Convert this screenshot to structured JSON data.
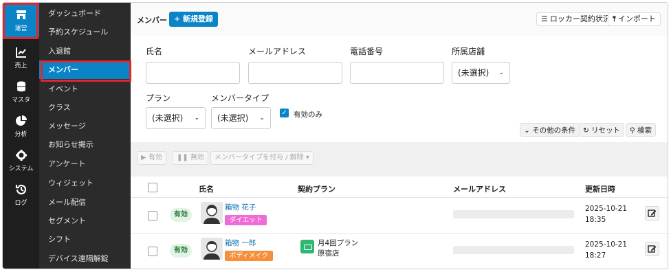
{
  "rail": {
    "items": [
      {
        "label": "運営",
        "icon": "store-icon",
        "active": true
      },
      {
        "label": "売上",
        "icon": "chart-line-icon"
      },
      {
        "label": "マスタ",
        "icon": "database-icon"
      },
      {
        "label": "分析",
        "icon": "pie-chart-icon"
      },
      {
        "label": "システム",
        "icon": "gear-icon"
      },
      {
        "label": "ログ",
        "icon": "history-icon"
      }
    ]
  },
  "nav": {
    "items": [
      {
        "label": "ダッシュボード"
      },
      {
        "label": "予約スケジュール"
      },
      {
        "label": "入退館"
      },
      {
        "label": "メンバー",
        "active": true
      },
      {
        "label": "イベント"
      },
      {
        "label": "クラス"
      },
      {
        "label": "メッセージ"
      },
      {
        "label": "お知らせ掲示"
      },
      {
        "label": "アンケート"
      },
      {
        "label": "ウィジェット"
      },
      {
        "label": "メール配信"
      },
      {
        "label": "セグメント"
      },
      {
        "label": "シフト"
      },
      {
        "label": "デバイス遠隔解錠"
      }
    ]
  },
  "header": {
    "title": "メンバー",
    "new_button": "新規登録",
    "locker_button": "ロッカー契約状況",
    "import_button": "インポート"
  },
  "search": {
    "name_label": "氏名",
    "name_value": "",
    "email_label": "メールアドレス",
    "email_value": "",
    "phone_label": "電話番号",
    "phone_value": "",
    "store_label": "所属店舗",
    "store_value": "(未選択)",
    "plan_label": "プラン",
    "plan_value": "(未選択)",
    "type_label": "メンバータイプ",
    "type_value": "(未選択)",
    "active_only_label": "有効のみ",
    "active_only_checked": true,
    "more_conditions": "その他の条件",
    "reset": "リセット",
    "search": "検索"
  },
  "actions": {
    "enable": "有効",
    "disable": "無効",
    "member_type": "メンバータイプを付与 / 解除"
  },
  "table": {
    "headers": {
      "name": "氏名",
      "plan": "契約プラン",
      "email": "メールアドレス",
      "updated": "更新日時"
    },
    "rows": [
      {
        "status": "有効",
        "name": "箱物 花子",
        "tag": "ダイエット",
        "tag_color": "#f06bd6",
        "avatar": "female",
        "plan_name": "",
        "plan_store": "",
        "has_plan": false,
        "updated_date": "2025-10-21",
        "updated_time": "18:35"
      },
      {
        "status": "有効",
        "name": "箱物 一郎",
        "tag": "ボディメイク",
        "tag_color": "#f58f3b",
        "avatar": "male",
        "plan_name": "月4回プラン",
        "plan_store": "原宿店",
        "has_plan": true,
        "updated_date": "2025-10-21",
        "updated_time": "18:27"
      }
    ]
  },
  "colors": {
    "accent": "#0a84c6",
    "highlight": "#e0272c",
    "status_bg": "#e2f3e5"
  }
}
